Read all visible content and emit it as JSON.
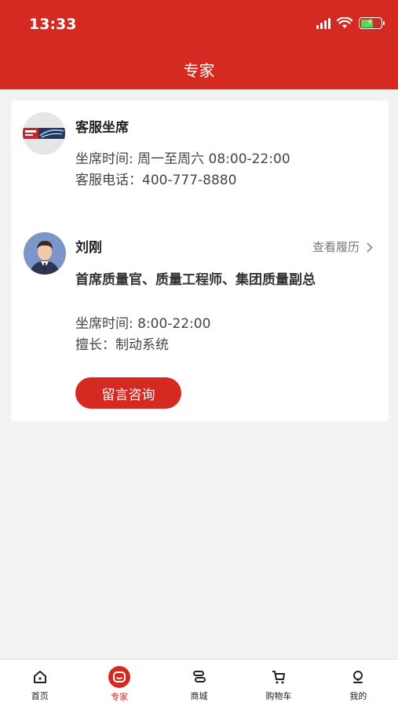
{
  "status": {
    "time": "13:33"
  },
  "header": {
    "title": "专家"
  },
  "service": {
    "name": "客服坐席",
    "hours": "坐席时间: 周一至周六 08:00-22:00",
    "phone": "客服电话：400-777-8880"
  },
  "expert": {
    "name": "刘刚",
    "view_resume": "查看履历",
    "titles": "首席质量官、质量工程师、集团质量副总",
    "hours": "坐席时间: 8:00-22:00",
    "specialty": "擅长：制动系统",
    "consult_button": "留言咨询"
  },
  "tabbar": {
    "items": [
      {
        "label": "首页",
        "icon": "home-icon"
      },
      {
        "label": "专家",
        "icon": "expert-chat-icon",
        "active": true
      },
      {
        "label": "商城",
        "icon": "shop-icon"
      },
      {
        "label": "购物车",
        "icon": "cart-icon"
      },
      {
        "label": "我的",
        "icon": "profile-icon"
      }
    ]
  },
  "colors": {
    "brand": "#d42a22",
    "background": "#f2f2f2"
  }
}
